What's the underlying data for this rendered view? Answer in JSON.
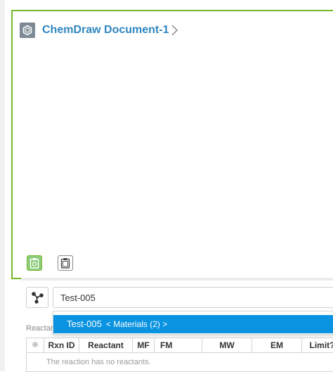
{
  "document": {
    "title": "ChemDraw Document-1"
  },
  "search": {
    "value": "Test-005"
  },
  "dropdown": {
    "item_name": "Test-005",
    "item_detail": "< Materials (2) >"
  },
  "reactants": {
    "section_label": "Reactants",
    "columns": [
      "Rxn ID",
      "Reactant",
      "MF",
      "FM",
      "MW",
      "EM",
      "Limit?"
    ],
    "empty_message": "The reaction has no reactants."
  },
  "colors": {
    "panel_border": "#76b82a",
    "title": "#2e86c1",
    "dropdown_highlight": "#0a93e0"
  },
  "icons": {
    "document": "chemdraw-document-icon",
    "title_chevron": "chevron-right-icon",
    "paste_structure": "clipboard-structure-icon",
    "paste": "clipboard-icon",
    "structure_search": "molecule-icon",
    "settings": "gear-icon"
  }
}
